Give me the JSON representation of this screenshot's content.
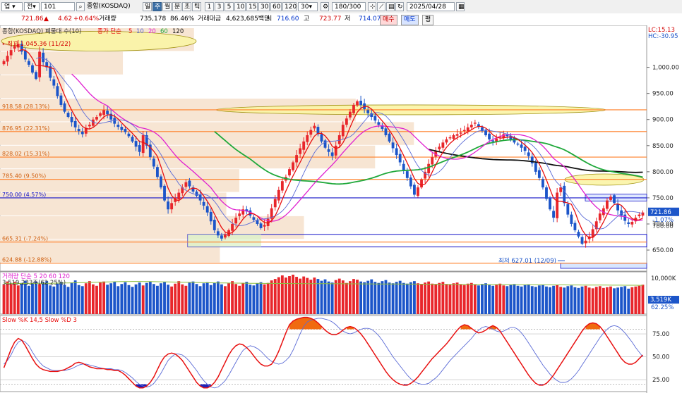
{
  "toolbar": {
    "mode": "업",
    "mode2": "전",
    "code": "101",
    "index_name": "종합(KOSDAQ)",
    "periods": [
      "일",
      "주",
      "월",
      "분",
      "초",
      "틱"
    ],
    "active_period": "주",
    "minutes": [
      "1",
      "3",
      "5",
      "10",
      "15",
      "30",
      "60",
      "120",
      "30"
    ],
    "count": "180/300",
    "date": "2025/04/28"
  },
  "info": {
    "price": "721.86",
    "change": "4.62",
    "change_pct": "+0.64%",
    "volume_label": "거래량",
    "volume": "735,178",
    "volume_ratio": "86.46%",
    "value_label": "거래대금",
    "value": "4,623,685백만",
    "open_label": "시",
    "open": "716.60",
    "high_label": "고",
    "high": "723.77",
    "low_label": "저",
    "low": "714.07",
    "buy": "매수",
    "sell": "매도",
    "flat": "평"
  },
  "colors": {
    "up": "#e8262b",
    "down": "#1c55c9",
    "ma5": "#e81010",
    "ma10": "#5b6bd6",
    "ma20": "#e020d0",
    "ma60": "#1fa83a",
    "ma120": "#111111"
  },
  "chart_data": [
    {
      "type": "candlestick",
      "title": "종합(KOSDAQ) 폐물대 수(10)",
      "legend": {
        "label": "종가 단순",
        "periods": [
          "5",
          "10",
          "20",
          "60",
          "120"
        ]
      },
      "y_ticks": [
        1000,
        950,
        900,
        850,
        800,
        750,
        700,
        650
      ],
      "y_tick_labels": [
        "1,000.00",
        "950.00",
        "900.00",
        "850.00",
        "800.00",
        "750.00",
        "700.00",
        "650.00"
      ],
      "ylim": [
        615,
        1075
      ],
      "x_count": 180,
      "corner_labels": [
        "LC:15.13",
        "HC:-30.95"
      ],
      "current_price": "721.86",
      "current_change": "-1.07%",
      "price_scale_note": "700.00",
      "annotations": {
        "high": {
          "label": "←최고 1,045.36 (11/22)",
          "value": 1045.36,
          "index": 10
        },
        "low": {
          "label": "최저 627.01 (12/09)",
          "value": 627.01,
          "index": 153
        }
      },
      "levels": [
        {
          "value": 918.58,
          "label": "918.58 (28.13%)",
          "color": "#ff7f27"
        },
        {
          "value": 876.95,
          "label": "876.95 (22.31%)",
          "color": "#ff7f27"
        },
        {
          "value": 828.02,
          "label": "828.02 (15.31%)",
          "color": "#ff7f27"
        },
        {
          "value": 785.4,
          "label": "785.40 (9.50%)",
          "color": "#ff7f27"
        },
        {
          "value": 750.0,
          "label": "750.00 (4.57%)",
          "color": "#1414c8"
        },
        {
          "value": 665.31,
          "label": "665.31 (-7.24%)",
          "color": "#ff7f27"
        },
        {
          "value": 624.88,
          "label": "624.88 (-12.88%)",
          "color": "#ff7f27"
        }
      ],
      "volume_profile": [
        {
          "low": 1030,
          "high": 1075,
          "len": 30
        },
        {
          "low": 985,
          "high": 1030,
          "len": 19
        },
        {
          "low": 940,
          "high": 985,
          "len": 10
        },
        {
          "low": 895,
          "high": 940,
          "len": 55
        },
        {
          "low": 850,
          "high": 895,
          "len": 64
        },
        {
          "low": 805,
          "high": 850,
          "len": 58
        },
        {
          "low": 760,
          "high": 805,
          "len": 37
        },
        {
          "low": 715,
          "high": 760,
          "len": 35
        },
        {
          "low": 670,
          "high": 715,
          "len": 47
        },
        {
          "low": 625,
          "high": 670,
          "len": 34
        }
      ],
      "close": [
        1012,
        1022,
        1033,
        1040,
        1045,
        1030,
        1015,
        1005,
        990,
        978,
        1030,
        1010,
        1000,
        980,
        965,
        945,
        928,
        915,
        905,
        895,
        885,
        878,
        872,
        884,
        890,
        900,
        905,
        912,
        918,
        910,
        900,
        892,
        886,
        880,
        876,
        868,
        858,
        848,
        838,
        870,
        850,
        828,
        810,
        790,
        770,
        745,
        728,
        740,
        750,
        760,
        770,
        780,
        772,
        762,
        754,
        745,
        735,
        722,
        705,
        688,
        678,
        672,
        680,
        688,
        700,
        712,
        720,
        728,
        724,
        716,
        708,
        700,
        692,
        698,
        710,
        730,
        748,
        765,
        782,
        790,
        805,
        818,
        832,
        845,
        858,
        870,
        880,
        888,
        872,
        858,
        846,
        838,
        830,
        850,
        870,
        890,
        902,
        915,
        928,
        935,
        928,
        920,
        912,
        905,
        898,
        890,
        882,
        870,
        858,
        845,
        832,
        818,
        802,
        788,
        772,
        756,
        770,
        785,
        800,
        815,
        828,
        840,
        848,
        856,
        862,
        866,
        870,
        872,
        875,
        880,
        885,
        890,
        894,
        886,
        878,
        870,
        862,
        858,
        864,
        868,
        872,
        868,
        862,
        856,
        852,
        846,
        840,
        830,
        816,
        800,
        788,
        770,
        748,
        728,
        712,
        760,
        770,
        740,
        718,
        700,
        688,
        676,
        662,
        668,
        676,
        690,
        705,
        720,
        730,
        745,
        752,
        740,
        726,
        716,
        706,
        700,
        704,
        712,
        718,
        722
      ]
    },
    {
      "type": "bar",
      "title": "거래량 단순 5 20 60 120",
      "legend_periods": [
        "5",
        "20",
        "60",
        "120"
      ],
      "summary": "3,519,233주(62.25%)",
      "y_tick_labels": [
        "10,000K"
      ],
      "current_label": "3,519K",
      "current_pct": "62.25%",
      "scale_k": [
        0,
        11000
      ],
      "values_k": [
        8200,
        9100,
        8400,
        9000,
        8000,
        8700,
        9300,
        7900,
        8600,
        9100,
        8400,
        8900,
        9200,
        8000,
        7700,
        8500,
        9000,
        8200,
        7600,
        8800,
        9400,
        8100,
        7800,
        8600,
        9200,
        8300,
        7900,
        8800,
        9100,
        8200,
        8600,
        9000,
        7800,
        8400,
        8900,
        8100,
        7600,
        8300,
        8800,
        8000,
        8700,
        9100,
        8400,
        7900,
        8600,
        9000,
        8200,
        7700,
        8500,
        9200,
        8300,
        7900,
        8800,
        9100,
        8400,
        7800,
        8600,
        8900,
        8100,
        8700,
        9100,
        8300,
        7800,
        8600,
        9200,
        8400,
        7900,
        8700,
        9000,
        8200,
        8000,
        8600,
        8900,
        8300,
        8700,
        9400,
        9800,
        10300,
        10800,
        10200,
        10600,
        11000,
        10400,
        9900,
        10500,
        10100,
        9600,
        10200,
        9800,
        9300,
        9700,
        9100,
        8800,
        9500,
        9900,
        9400,
        8700,
        9200,
        9800,
        9600,
        9100,
        8900,
        9300,
        9700,
        9000,
        8700,
        9200,
        9500,
        8800,
        8600,
        9000,
        9300,
        8700,
        8500,
        8900,
        9200,
        8600,
        8400,
        8800,
        9100,
        8500,
        8300,
        8700,
        9000,
        8400,
        8200,
        8600,
        8800,
        8300,
        8100,
        8500,
        8700,
        8200,
        8000,
        8400,
        8600,
        8100,
        7900,
        8300,
        8500,
        8000,
        7800,
        8200,
        8400,
        7900,
        7700,
        8100,
        8300,
        7800,
        7600,
        8000,
        8200,
        7700,
        7500,
        7900,
        8100,
        7600,
        7400,
        7800,
        8000,
        7500,
        7300,
        7700,
        7900,
        7400,
        7200,
        7600,
        7800,
        7300,
        7500,
        7700,
        7200,
        7400,
        7600,
        7800,
        7100,
        7500,
        7700,
        7900,
        8200
      ],
      "ma_k": [
        8600,
        8580,
        8560,
        8560,
        8550,
        8550,
        8560,
        8560,
        8570,
        8580,
        8580,
        8590,
        8600,
        8610,
        8620,
        8640,
        8660,
        8680,
        8700,
        8720,
        8740,
        8760,
        8780,
        8800,
        8820,
        8850,
        8880,
        8910,
        8940,
        8970,
        9000,
        9030,
        9050,
        9070,
        9090,
        9100,
        9110,
        9110,
        9110,
        9100,
        9090,
        9080,
        9060,
        9040,
        9020,
        9000,
        8980,
        8960,
        8940,
        8920,
        8900,
        8880,
        8860,
        8840,
        8820,
        8800,
        8780,
        8760,
        8740,
        8720,
        8700,
        8690,
        8680,
        8670,
        8660,
        8650,
        8640,
        8630,
        8620,
        8610,
        8600,
        8590,
        8580,
        8570,
        8560,
        8560,
        8550,
        8550,
        8540,
        8540,
        8530,
        8530,
        8520,
        8520,
        8510,
        8510,
        8500,
        8500,
        8490,
        8490,
        8480,
        8480,
        8470,
        8470,
        8460,
        8460,
        8450,
        8450,
        8440,
        8440,
        8430,
        8430,
        8420,
        8420,
        8410,
        8410,
        8400,
        8400,
        8390,
        8390,
        8380,
        8380,
        8370,
        8370,
        8360,
        8360,
        8350,
        8350,
        8340,
        8340,
        8330,
        8330,
        8320,
        8320,
        8310,
        8310,
        8300,
        8300,
        8290,
        8290,
        8280,
        8280,
        8270,
        8270,
        8260,
        8260,
        8250,
        8250,
        8240,
        8240,
        8230,
        8230,
        8220,
        8220,
        8210,
        8210,
        8200,
        8200,
        8190,
        8190,
        8180,
        8180,
        8170,
        8170,
        8160,
        8160,
        8150,
        8150,
        8140,
        8140,
        8130,
        8130,
        8120,
        8120,
        8110,
        8110,
        8100,
        8100,
        8090,
        8090,
        8080,
        8080,
        8070,
        8070,
        8060,
        8060,
        8050,
        8050,
        8040,
        8040
      ]
    },
    {
      "type": "line",
      "title": "Slow %K 14,5 Slow %D 3",
      "y_ticks": [
        75,
        50,
        25
      ],
      "y_tick_labels": [
        "75.00",
        "50.00",
        "25.00"
      ],
      "ylim": [
        12,
        95
      ],
      "overbought": 80,
      "oversold": 20,
      "k": [
        38,
        48,
        58,
        66,
        70,
        68,
        62,
        55,
        48,
        42,
        38,
        36,
        35,
        34,
        34,
        34,
        35,
        36,
        38,
        40,
        43,
        44,
        43,
        41,
        39,
        38,
        37,
        37,
        37,
        36,
        36,
        35,
        35,
        33,
        30,
        26,
        22,
        18,
        16,
        16,
        18,
        22,
        28,
        36,
        44,
        50,
        53,
        54,
        53,
        50,
        46,
        40,
        34,
        28,
        22,
        18,
        16,
        16,
        18,
        22,
        28,
        36,
        44,
        52,
        58,
        62,
        64,
        63,
        60,
        56,
        51,
        46,
        42,
        40,
        40,
        42,
        48,
        56,
        66,
        76,
        85,
        89,
        91,
        92,
        93,
        93,
        92,
        90,
        87,
        83,
        79,
        76,
        74,
        74,
        76,
        79,
        82,
        83,
        82,
        79,
        75,
        70,
        64,
        58,
        52,
        46,
        40,
        34,
        29,
        25,
        22,
        20,
        19,
        19,
        21,
        24,
        28,
        33,
        38,
        43,
        48,
        52,
        56,
        60,
        64,
        69,
        74,
        79,
        83,
        85,
        84,
        81,
        78,
        76,
        77,
        79,
        82,
        84,
        82,
        78,
        72,
        66,
        60,
        54,
        48,
        42,
        36,
        30,
        25,
        21,
        19,
        19,
        21,
        25,
        30,
        36,
        42,
        48,
        54,
        60,
        66,
        72,
        78,
        83,
        86,
        87,
        86,
        83,
        78,
        72,
        66,
        60,
        54,
        48,
        44,
        42,
        42,
        44,
        48,
        52
      ],
      "d": [
        42,
        46,
        52,
        60,
        66,
        68,
        66,
        62,
        55,
        49,
        44,
        40,
        38,
        36,
        35,
        35,
        35,
        35,
        36,
        37,
        39,
        41,
        42,
        42,
        41,
        40,
        39,
        38,
        37,
        37,
        37,
        36,
        36,
        35,
        33,
        30,
        27,
        23,
        20,
        18,
        17,
        18,
        21,
        26,
        32,
        39,
        46,
        50,
        53,
        53,
        52,
        49,
        45,
        40,
        35,
        29,
        24,
        20,
        17,
        16,
        17,
        20,
        24,
        30,
        37,
        44,
        51,
        57,
        60,
        62,
        61,
        59,
        56,
        52,
        48,
        45,
        43,
        42,
        43,
        46,
        50,
        57,
        66,
        75,
        83,
        88,
        90,
        91,
        92,
        92,
        91,
        90,
        88,
        85,
        81,
        78,
        76,
        75,
        76,
        78,
        80,
        81,
        81,
        80,
        77,
        73,
        68,
        62,
        56,
        50,
        45,
        40,
        35,
        30,
        26,
        23,
        21,
        20,
        20,
        21,
        24,
        27,
        31,
        36,
        41,
        46,
        50,
        54,
        58,
        62,
        66,
        70,
        75,
        79,
        82,
        83,
        82,
        80,
        78,
        77,
        78,
        80,
        82,
        82,
        80,
        76,
        71,
        65,
        59,
        53,
        47,
        41,
        36,
        31,
        27,
        24,
        22,
        22,
        23,
        26,
        30,
        35,
        41,
        47,
        53,
        59,
        65,
        71,
        76,
        80,
        83,
        84,
        83,
        80,
        76,
        71,
        66,
        60,
        55,
        50
      ]
    }
  ]
}
